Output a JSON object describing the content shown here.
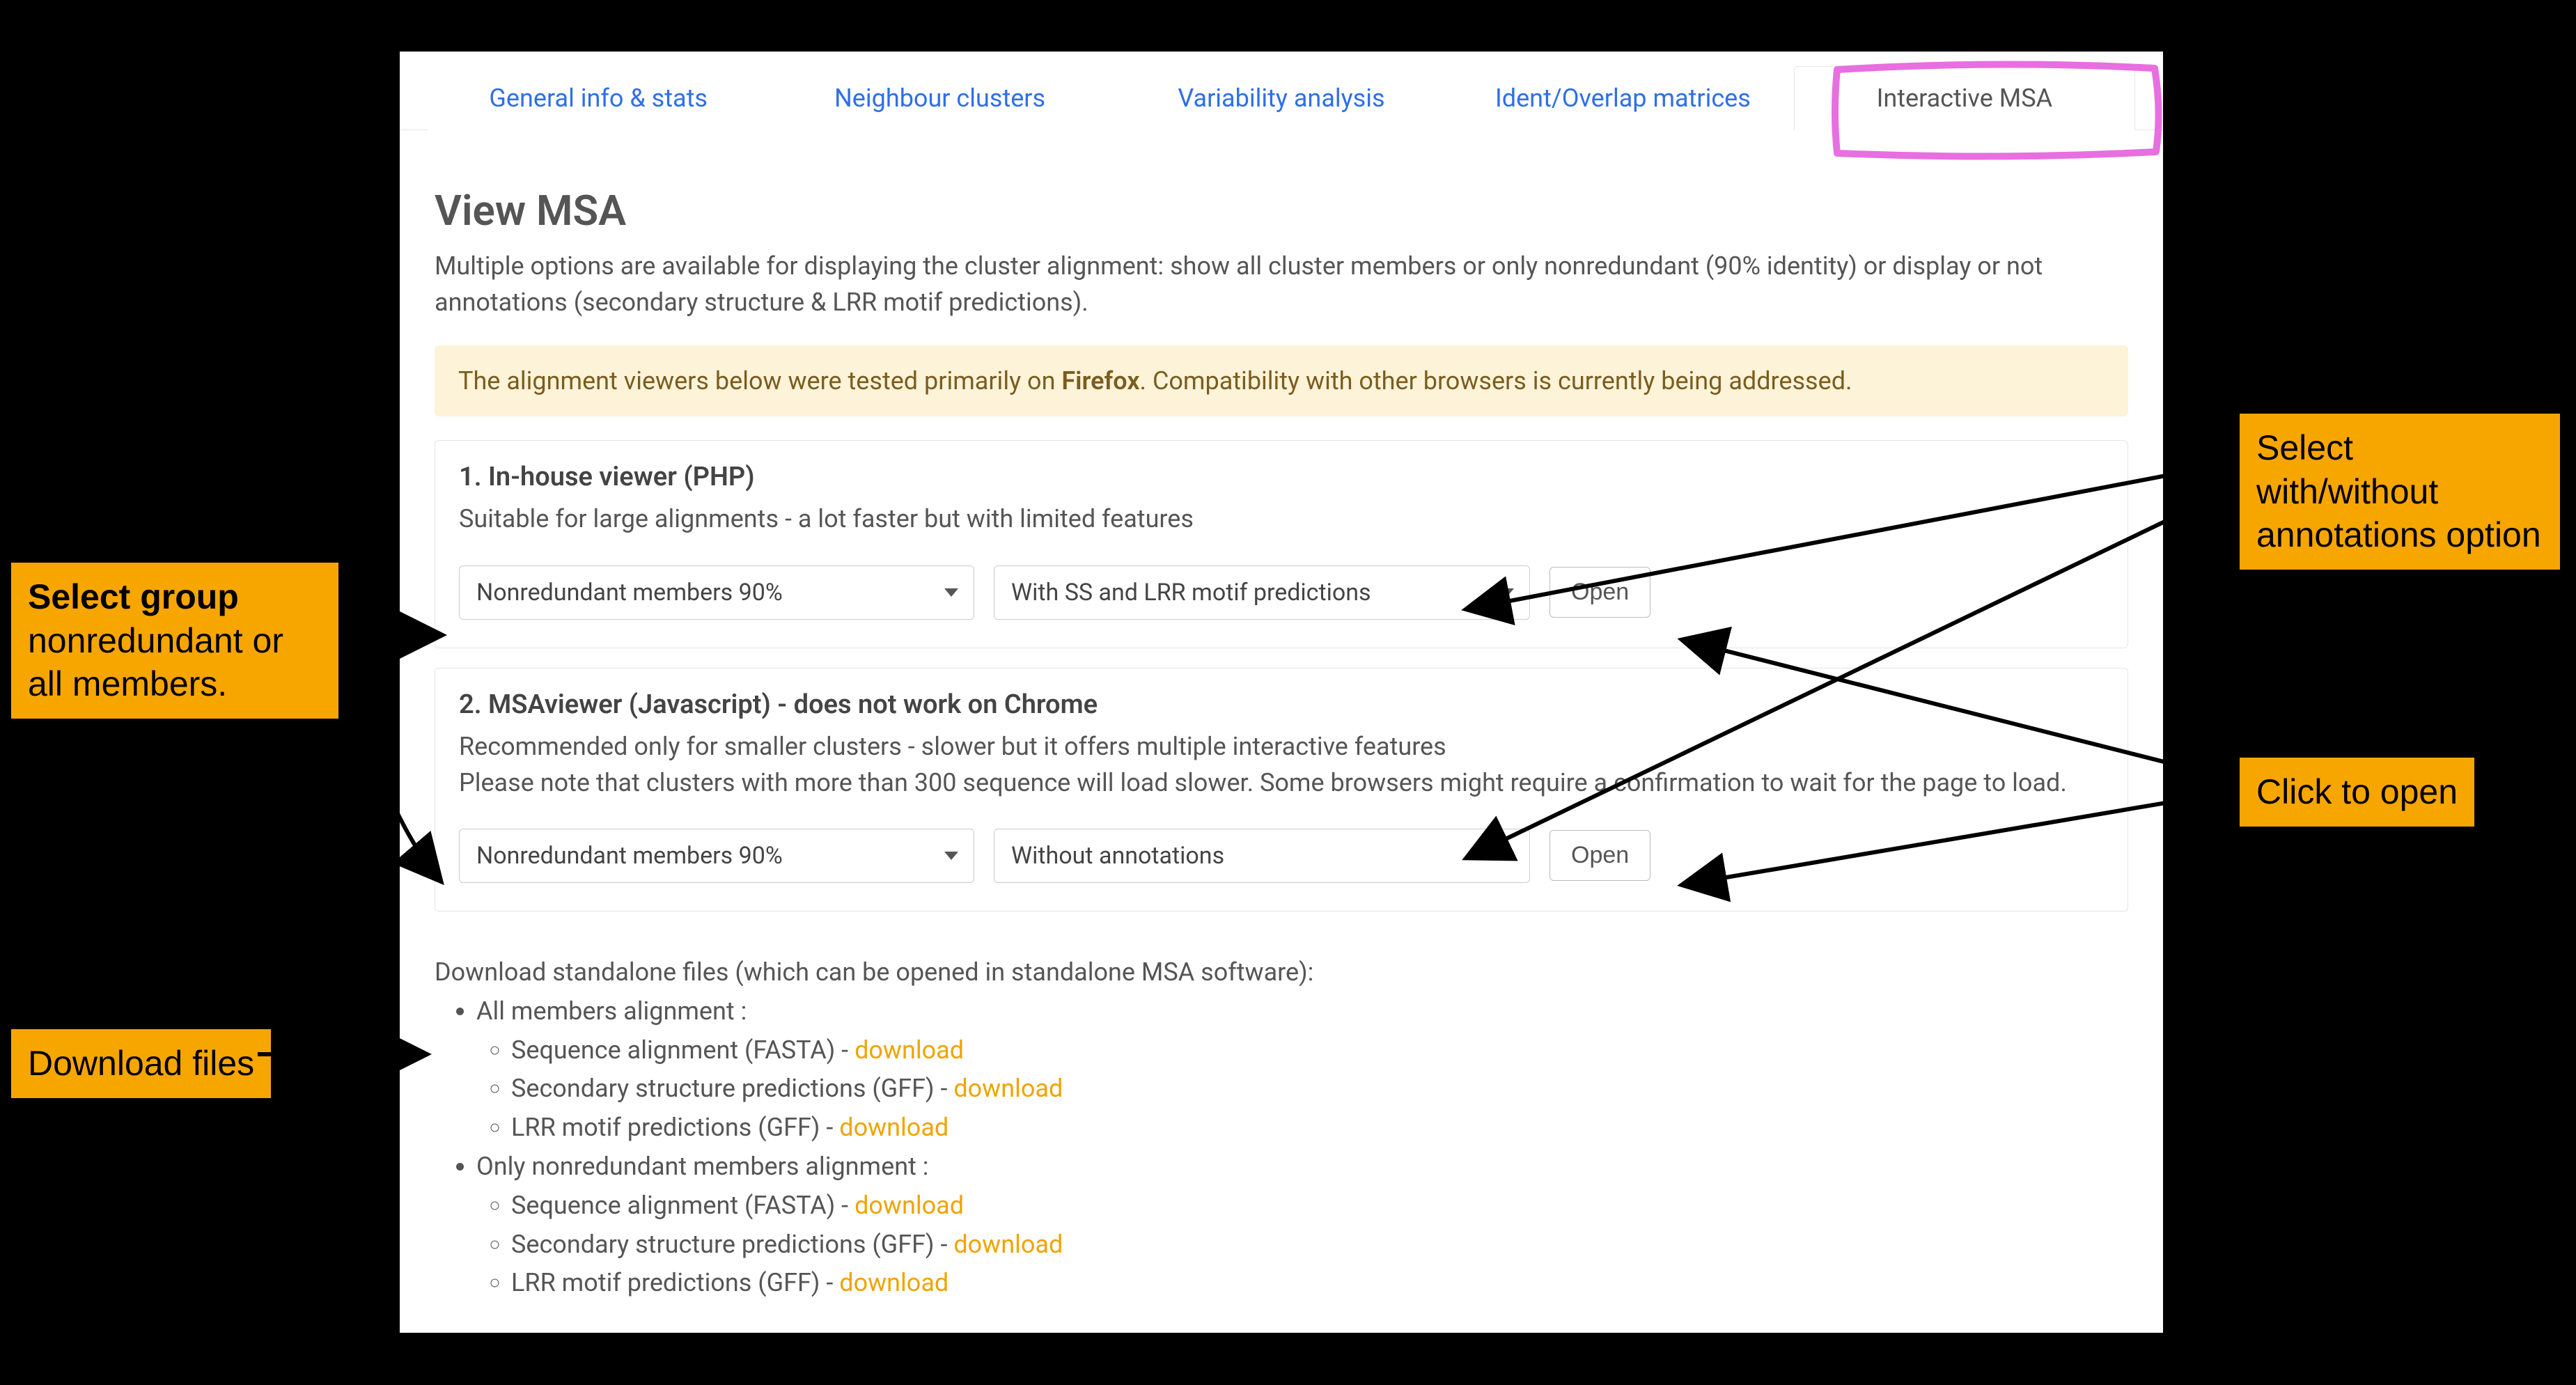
{
  "tabs": {
    "general": "General info & stats",
    "neighbour": "Neighbour clusters",
    "variability": "Variability analysis",
    "matrices": "Ident/Overlap matrices",
    "msa": "Interactive MSA"
  },
  "page": {
    "title": "View MSA",
    "desc": "Multiple options are available for displaying the cluster alignment: show all cluster members or only nonredundant (90% identity) or display or not annotations (secondary structure & LRR motif predictions).",
    "alert_prefix": "The alignment viewers below were tested primarily on ",
    "alert_bold": "Firefox",
    "alert_suffix": ". Compatibility with other browsers is currently being addressed."
  },
  "viewer1": {
    "heading": "1. In-house viewer (PHP)",
    "sub": "Suitable for large alignments - a lot faster but with limited features",
    "group": "Nonredundant members 90%",
    "annot": "With SS and LRR motif predictions",
    "open": "Open"
  },
  "viewer2": {
    "heading": "2. MSAviewer (Javascript) - does not work on Chrome",
    "sub1": "Recommended only for smaller clusters - slower but it offers multiple interactive features",
    "sub2": "Please note that clusters with more than 300 sequence will load slower. Some browsers might require a confirmation to wait for the page to load.",
    "group": "Nonredundant members 90%",
    "annot": "Without annotations",
    "open": "Open"
  },
  "downloads": {
    "intro": "Download standalone files (which can be opened in standalone MSA software):",
    "all_label": "All members alignment :",
    "nr_label": "Only nonredundant members alignment :",
    "items": {
      "fasta": "Sequence alignment (FASTA) - ",
      "ss": "Secondary structure predictions (GFF) - ",
      "lrr": "LRR motif predictions (GFF) - "
    },
    "link": "download"
  },
  "callouts": {
    "select_group_bold": "Select group",
    "select_group_rest": "nonredundant or all members.",
    "download": "Download files",
    "annot": "Select with/without annotations option",
    "click_open": "Click to open"
  }
}
